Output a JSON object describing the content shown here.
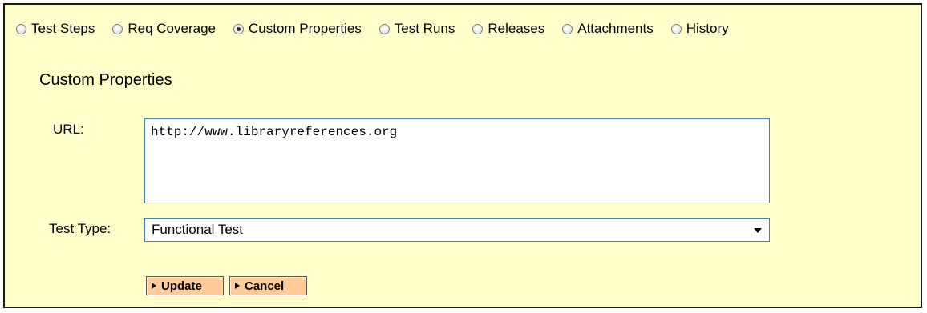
{
  "tabs": [
    {
      "label": "Test Steps",
      "selected": false,
      "icon": "radio-unchecked-icon"
    },
    {
      "label": "Req Coverage",
      "selected": false,
      "icon": "radio-unchecked-icon"
    },
    {
      "label": "Custom Properties",
      "selected": true,
      "icon": "radio-checked-icon"
    },
    {
      "label": "Test Runs",
      "selected": false,
      "icon": "radio-unchecked-icon"
    },
    {
      "label": "Releases",
      "selected": false,
      "icon": "radio-unchecked-icon"
    },
    {
      "label": "Attachments",
      "selected": false,
      "icon": "radio-unchecked-icon"
    },
    {
      "label": "History",
      "selected": false,
      "icon": "radio-unchecked-icon"
    }
  ],
  "section": {
    "title": "Custom Properties"
  },
  "fields": {
    "url": {
      "label": "URL:",
      "value": "http://www.libraryreferences.org"
    },
    "test_type": {
      "label": "Test Type:",
      "value": "Functional Test",
      "icon": "dropdown-arrow-icon"
    }
  },
  "buttons": {
    "update_label": "Update",
    "cancel_label": "Cancel",
    "icon": "play-arrow-icon"
  },
  "colors": {
    "panel_background": "#ffffcc",
    "panel_border": "#1a1a1a",
    "button_background": "#ffcc99",
    "input_border": "#3e7fbf"
  }
}
